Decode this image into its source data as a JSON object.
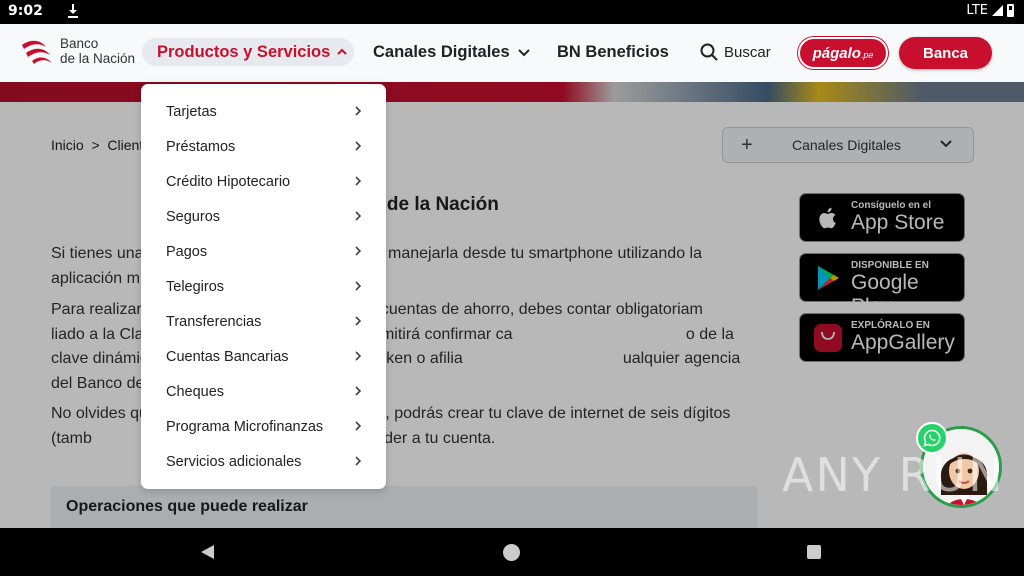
{
  "status_bar": {
    "time": "9:02",
    "network": "LTE"
  },
  "header": {
    "logo_line1": "Banco",
    "logo_line2": "de la Nación",
    "nav": {
      "productos": "Productos y Servicios",
      "canales": "Canales Digitales",
      "beneficios": "BN Beneficios",
      "buscar": "Buscar"
    },
    "pagalo": "págalo",
    "pagalo_suffix": ".pe",
    "banca": "Banca"
  },
  "breadcrumb": "Inicio  >  Cliente",
  "canales_dropdown": {
    "plus": "+",
    "label": "Canales Digitales"
  },
  "content": {
    "heading": "o de la Nación",
    "p1": "Si tienes una                                           podrás manejarla desde tu smartphone utilizando la aplicación m",
    "p2": "Para realizar                                          o a tus cuentas de ahorro, debes contar obligatoriam                                     liado a la Clave Dinámica Digital, lo cual te permitirá confirmar ca                                       o de la clave dinámica generada. Puedes solicitar tu token o afilia                                    ualquier agencia del Banco de la Nación.",
    "p3": "No olvides qu                                        ón móvil, podrás crear tu clave de internet de seis dígitos (tamb                                        d Virtual) y acceder a tu cuenta.",
    "ops": "Operaciones que puede realizar"
  },
  "stores": [
    {
      "small": "Consíguelo en el",
      "big": "App Store",
      "icon": "apple-icon"
    },
    {
      "small": "DISPONIBLE EN",
      "big": "Google Play",
      "icon": "google-play-icon"
    },
    {
      "small": "EXPLÓRALO EN",
      "big": "AppGallery",
      "icon": "huawei-icon"
    }
  ],
  "menu": {
    "items": [
      {
        "label": "Tarjetas"
      },
      {
        "label": "Préstamos"
      },
      {
        "label": "Crédito Hipotecario"
      },
      {
        "label": "Seguros"
      },
      {
        "label": "Pagos"
      },
      {
        "label": "Telegiros"
      },
      {
        "label": "Transferencias"
      },
      {
        "label": "Cuentas Bancarias"
      },
      {
        "label": "Cheques"
      },
      {
        "label": "Programa Microfinanzas"
      },
      {
        "label": "Servicios adicionales"
      }
    ]
  },
  "watermark": "ANY RUN",
  "colors": {
    "brand_red": "#c8102e",
    "whatsapp": "#25d366"
  }
}
